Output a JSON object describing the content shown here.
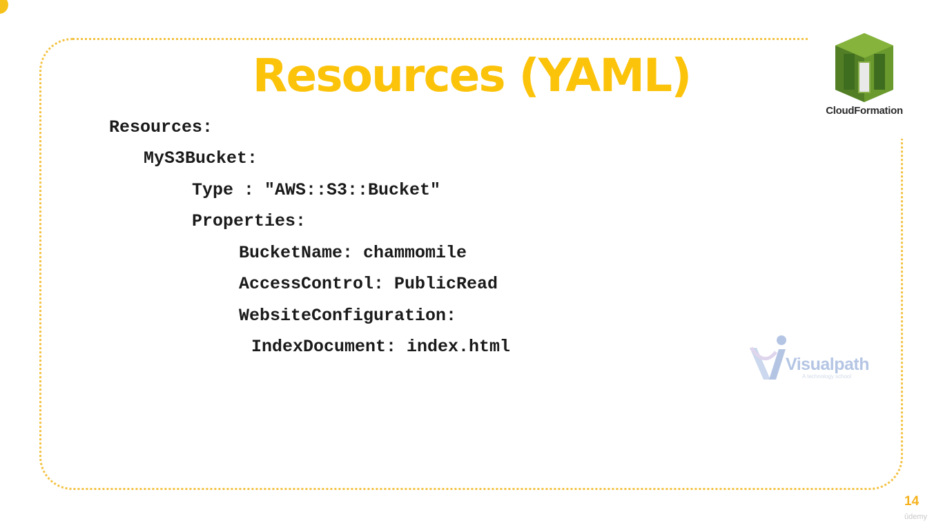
{
  "slide": {
    "title": "Resources (YAML)",
    "page_number": "14",
    "watermark_corner": "ûdemy"
  },
  "code_lines": [
    "Resources:",
    "MyS3Bucket:",
    "Type : \"AWS::S3::Bucket\"",
    "Properties:",
    "BucketName: chammomile",
    "AccessControl: PublicRead",
    "WebsiteConfiguration:",
    "IndexDocument: index.html"
  ],
  "logo": {
    "label": "CloudFormation",
    "icon": "aws-cloudformation-icon"
  },
  "watermark": {
    "name": "Visualpath",
    "tagline": "A technology school"
  },
  "colors": {
    "title": "#fcc30b",
    "frame": "#f3c242",
    "logo_green_dark": "#3f6d1f",
    "logo_green": "#6a9a2e",
    "logo_green_light": "#86b33c"
  }
}
